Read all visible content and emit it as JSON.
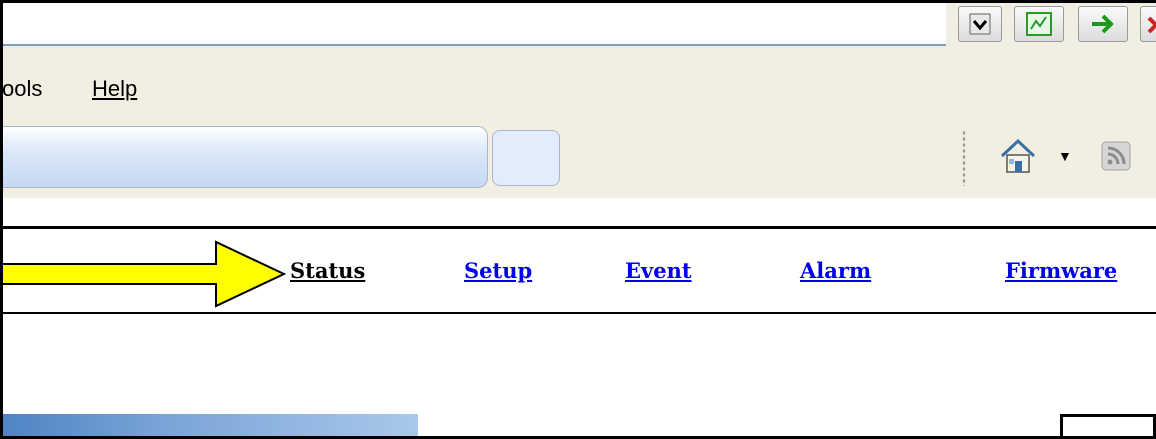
{
  "toolbar": {
    "dropdown_icon": "chevron-down-icon",
    "go_icon": "go-icon",
    "arrow_icon": "green-arrow-icon",
    "close_icon": "red-x-icon"
  },
  "menu": {
    "tools_label": "ools",
    "help_label": "Help"
  },
  "nav_toolbar": {
    "home_icon": "home-icon",
    "feed_icon": "rss-feed-icon"
  },
  "page_nav": {
    "links": [
      {
        "label": "Status",
        "current": true
      },
      {
        "label": "Setup"
      },
      {
        "label": "Event"
      },
      {
        "label": "Alarm"
      },
      {
        "label": "Firmware"
      }
    ]
  },
  "colors": {
    "link": "#0000ee",
    "current_link": "#000000",
    "arrow_fill": "#ffff00",
    "chrome": "#f1efe2"
  }
}
